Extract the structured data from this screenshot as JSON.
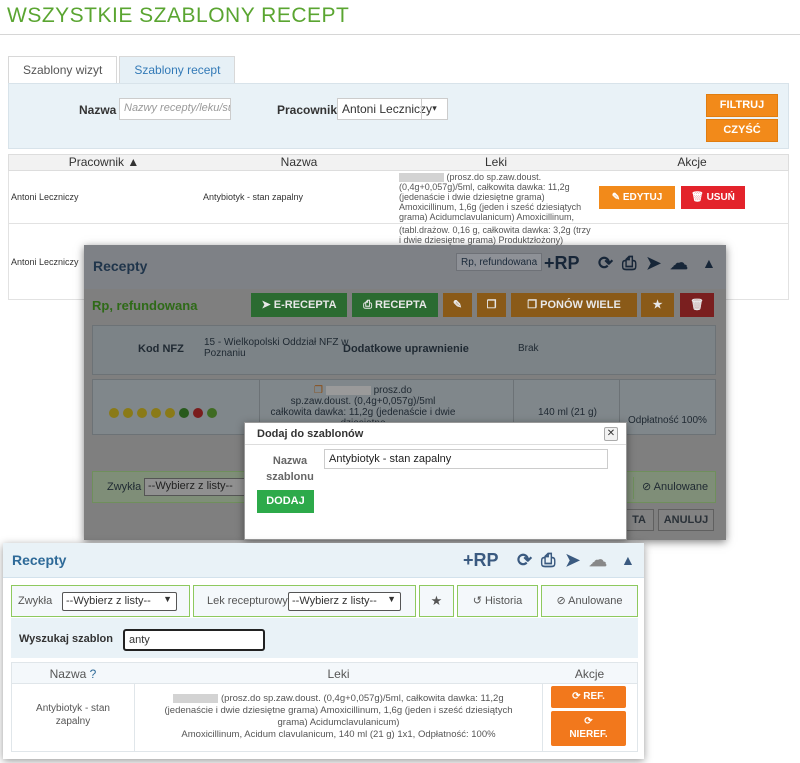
{
  "page": {
    "title": "WSZYSTKIE SZABLONY RECEPT"
  },
  "tabs": [
    {
      "label": "Szablony wizyt",
      "active": false
    },
    {
      "label": "Szablony recept",
      "active": true
    }
  ],
  "filter": {
    "nazwa_label": "Nazwa",
    "nazwa_placeholder": "Nazwy recepty/leku/subs",
    "pracownik_label": "Pracownik",
    "pracownik_value": "Antoni Leczniczy",
    "filtruj": "FILTRUJ",
    "czysc": "CZYŚĆ"
  },
  "table": {
    "headers": {
      "pracownik": "Pracownik ▲",
      "nazwa": "Nazwa",
      "leki": "Leki",
      "akcje": "Akcje"
    },
    "rows": [
      {
        "pracownik": "Antoni Leczniczy",
        "nazwa": "Antybiotyk - stan zapalny",
        "leki": "(prosz.do sp.zaw.doust. (0,4g+0,057g)/5ml, całkowita dawka: 11,2g (jedenaście i dwie dziesiętne grama) Amoxicillinum, 1,6g (jeden i sześć dziesiątych grama) Acidumclavulanicum) Amoxicillinum, Acidum clavulanicum, 140 ml (21 g), 1x1"
      },
      {
        "pracownik": "Antoni Leczniczy",
        "nazwa": "",
        "leki": "(tabl.drażow. 0,16 g, całkowita dawka: 3,2g (trzy i dwie dziesiętne grama) Produktzłożony) Produkt złożony, 30 tabl., 2x1"
      }
    ],
    "edytuj": "EDYTUJ",
    "usun": "USUŃ"
  },
  "modal": {
    "title": "Recepty",
    "rp_badge": "Rp, refundowana",
    "rp_plus": "+RP",
    "subtitle": "Rp, refundowana",
    "buttons": {
      "erecepta": "E-RECEPTA",
      "recepta": "RECEPTA",
      "ponow": "PONÓW WIELE"
    },
    "kod_nfz_label": "Kod NFZ",
    "kod_nfz_value": "15 - Wielkopolski Oddział NFZ w Poznaniu",
    "uprawnienie_label": "Dodatkowe uprawnienie",
    "uprawnienie_value": "Brak",
    "drug_line1": "prosz.do",
    "drug_line2": "sp.zaw.doust. (0,4g+0,057g)/5ml",
    "drug_line3": "całkowita dawka: 11,2g (jedenaście i dwie dziesiętne",
    "amount": "140 ml (21 g)",
    "odplatnosc": "Odpłatność 100%",
    "zwykla_label": "Zwykła",
    "zwykla_value": "--Wybierz z listy--",
    "anulowane": "Anulowane",
    "ta_btn": "TA",
    "anuluj": "ANULUJ"
  },
  "dialog": {
    "title": "Dodaj do szablonów",
    "label": "Nazwa szablonu",
    "value": "Antybiotyk - stan zapalny",
    "button": "DODAJ"
  },
  "bottom": {
    "title": "Recepty",
    "rp_plus": "+RP",
    "zwykla_label": "Zwykła",
    "zwykla_value": "--Wybierz z listy--",
    "lek_label": "Lek recepturowy",
    "lek_value": "--Wybierz z listy--",
    "historia": "Historia",
    "anulowane": "Anulowane",
    "search_label": "Wyszukaj szablon",
    "search_value": "anty",
    "headers": {
      "nazwa": "Nazwa",
      "leki": "Leki",
      "akcje": "Akcje"
    },
    "row": {
      "nazwa": "Antybiotyk - stan zapalny",
      "leki_1": "(prosz.do sp.zaw.doust. (0,4g+0,057g)/5ml, całkowita dawka: 11,2g",
      "leki_2": "(jedenaście i dwie dziesiętne grama) Amoxicillinum, 1,6g (jeden i sześć dziesiątych",
      "leki_3": "grama) Acidumclavulanicum)",
      "leki_4": "Amoxicillinum, Acidum clavulanicum, 140 ml (21 g) 1x1, Odpłatność: 100%"
    },
    "ref": "REF.",
    "nieref": "NIEREF."
  }
}
